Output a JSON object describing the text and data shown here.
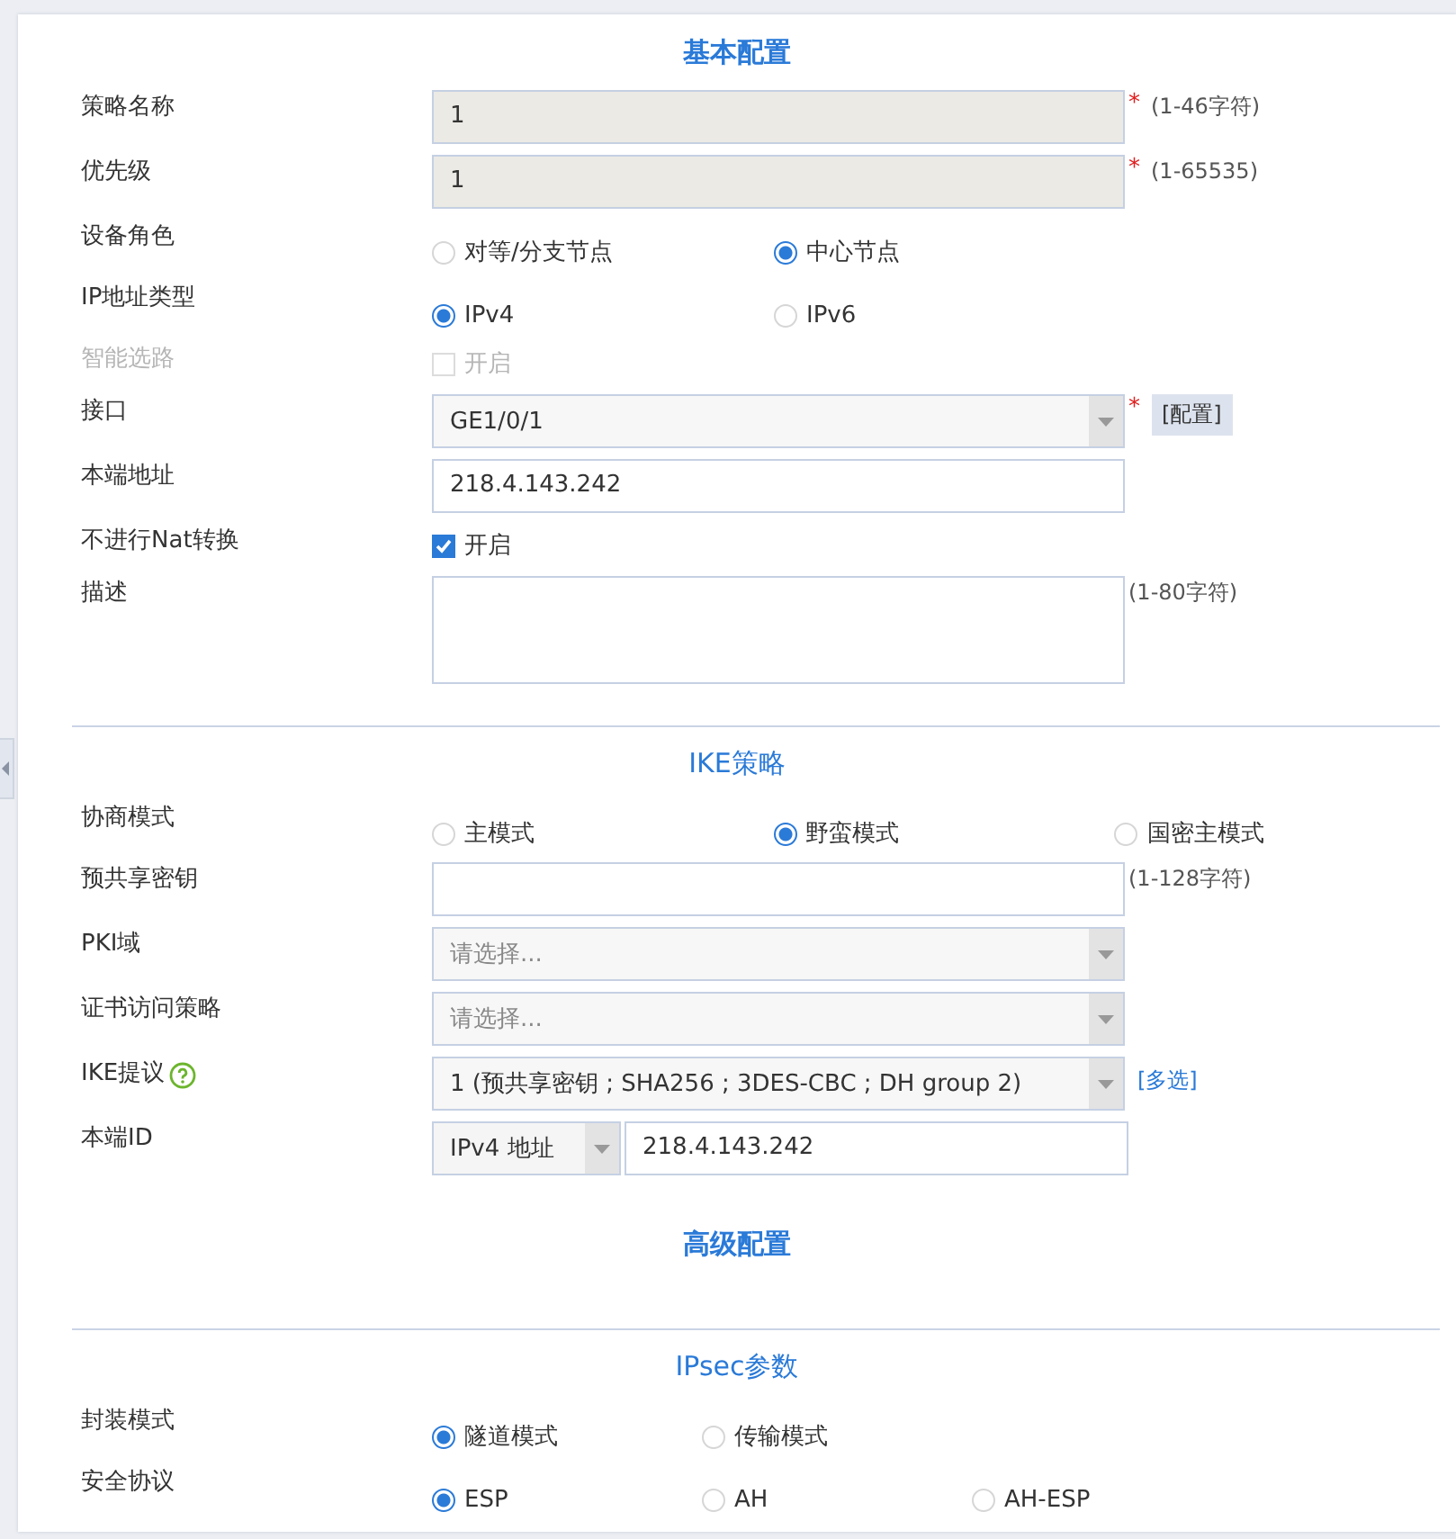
{
  "sections": [
    {
      "kind": "major",
      "title": "基本配置",
      "rows": [
        {
          "kind": "text",
          "label": "策略名称",
          "value": "1",
          "readonly": true,
          "required_mark": "*",
          "hint": "(1-46字符)"
        },
        {
          "kind": "text",
          "label": "优先级",
          "value": "1",
          "readonly": true,
          "required_mark": "*",
          "hint": "(1-65535)"
        },
        {
          "kind": "radio",
          "label": "设备角色",
          "options": [
            {
              "label": "对等/分支节点",
              "selected": false
            },
            {
              "label": "中心节点",
              "selected": true
            }
          ]
        },
        {
          "kind": "radio",
          "label": "IP地址类型",
          "options": [
            {
              "label": "IPv4",
              "selected": true
            },
            {
              "label": "IPv6",
              "selected": false
            }
          ]
        },
        {
          "kind": "checkbox",
          "label": "智能选路",
          "text": "开启",
          "checked": false,
          "disabled": true
        },
        {
          "kind": "select",
          "label": "接口",
          "value": "GE1/0/1",
          "required_mark": "*",
          "button": "[配置]"
        },
        {
          "kind": "text",
          "label": "本端地址",
          "value": "218.4.143.242",
          "readonly": false
        },
        {
          "kind": "checkbox",
          "label": "不进行Nat转换",
          "text": "开启",
          "checked": true,
          "disabled": false
        },
        {
          "kind": "textarea",
          "label": "描述",
          "hint": "(1-80字符)"
        }
      ]
    },
    {
      "kind": "minor",
      "title": "IKE策略",
      "rows": [
        {
          "kind": "radio",
          "label": "协商模式",
          "options": [
            {
              "label": "主模式",
              "selected": false
            },
            {
              "label": "野蛮模式",
              "selected": true
            },
            {
              "label": "国密主模式",
              "selected": false
            }
          ]
        },
        {
          "kind": "text",
          "label": "预共享密钥",
          "value": "",
          "readonly": false,
          "hint": "(1-128字符)"
        },
        {
          "kind": "select",
          "label": "PKI域",
          "placeholder": "请选择..."
        },
        {
          "kind": "select",
          "label": "证书访问策略",
          "placeholder": "请选择..."
        },
        {
          "kind": "select",
          "label": "IKE提议",
          "help": true,
          "value": "1 (预共享密钥 ; SHA256 ; 3DES-CBC ; DH group 2)",
          "link": "[多选]"
        },
        {
          "kind": "combo",
          "label": "本端ID",
          "choice": "IPv4 地址",
          "value": "218.4.143.242"
        }
      ]
    },
    {
      "kind": "major",
      "title": "高级配置"
    },
    {
      "kind": "minor",
      "title": "IPsec参数",
      "rows": [
        {
          "kind": "radio",
          "label": "封装模式",
          "narrow": true,
          "options": [
            {
              "label": "隧道模式",
              "selected": true
            },
            {
              "label": "传输模式",
              "selected": false
            }
          ]
        },
        {
          "kind": "radio",
          "label": "安全协议",
          "narrow": true,
          "options": [
            {
              "label": "ESP",
              "selected": true
            },
            {
              "label": "AH",
              "selected": false
            },
            {
              "label": "AH-ESP",
              "selected": false
            }
          ]
        }
      ]
    }
  ]
}
